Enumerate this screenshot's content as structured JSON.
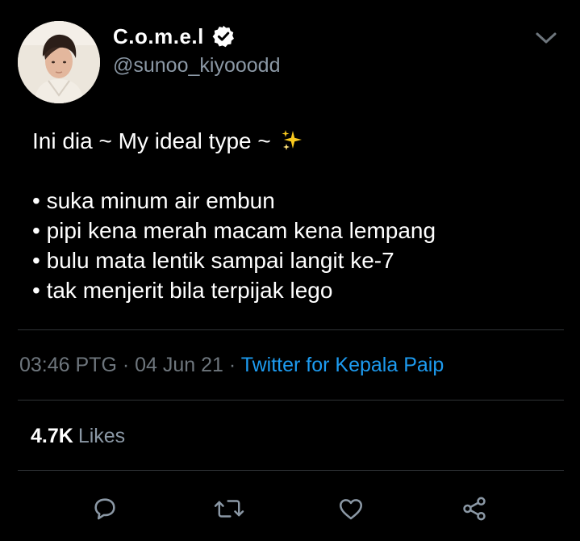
{
  "author": {
    "display_name": "C.o.m.e.l",
    "handle": "@sunoo_kiyooodd",
    "verified": true,
    "avatar_icon": "profile-photo"
  },
  "tweet": {
    "lines": [
      "Ini dia ~ My ideal type ~",
      "",
      "• suka minum air embun",
      "• pipi kena merah macam kena lempang",
      "• bulu mata lentik sampai langit ke-7",
      "• tak menjerit bila terpijak lego"
    ],
    "emoji_icon": "sparkles-icon"
  },
  "meta": {
    "time": "03:46 PTG",
    "separator": " · ",
    "date": "04 Jun 21",
    "source": "Twitter for Kepala Paip"
  },
  "stats": {
    "likes_count": "4.7K",
    "likes_label": "Likes"
  },
  "actions": [
    {
      "name": "reply",
      "icon": "comment-icon"
    },
    {
      "name": "retweet",
      "icon": "retweet-icon"
    },
    {
      "name": "like",
      "icon": "heart-icon"
    },
    {
      "name": "share",
      "icon": "share-icon"
    }
  ],
  "colors": {
    "background": "#000000",
    "text": "#ffffff",
    "secondary": "#8b98a5",
    "muted": "#6e767d",
    "link": "#1d9bf0",
    "divider": "#2f3336",
    "icon": "#8b98a5"
  }
}
